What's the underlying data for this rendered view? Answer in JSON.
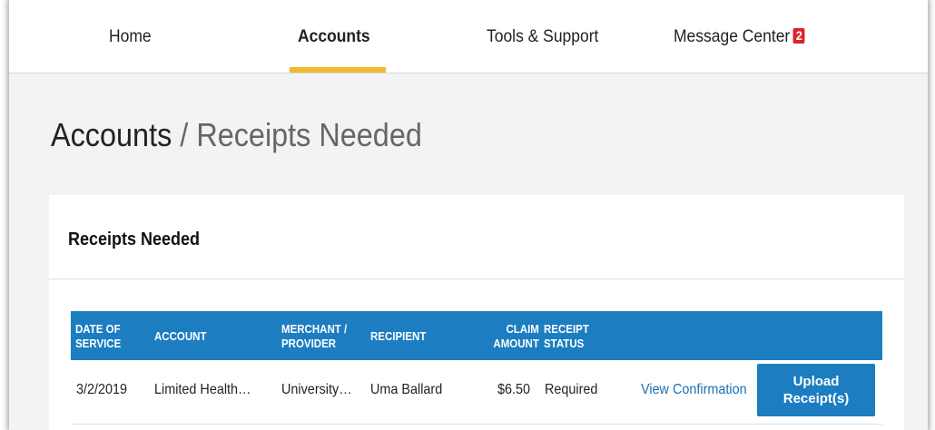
{
  "nav": {
    "items": [
      {
        "label": "Home"
      },
      {
        "label": "Accounts"
      },
      {
        "label": "Tools & Support"
      },
      {
        "label": "Message Center",
        "badge": "2"
      }
    ],
    "active": "Accounts"
  },
  "page": {
    "breadcrumb_root": "Accounts",
    "breadcrumb_sep": "/",
    "breadcrumb_current": "Receipts Needed"
  },
  "card": {
    "title": "Receipts Needed",
    "table": {
      "headers": {
        "date_line1": "DATE OF",
        "date_line2": "SERVICE",
        "account": "ACCOUNT",
        "merchant_line1": "MERCHANT /",
        "merchant_line2": "PROVIDER",
        "recipient": "RECIPIENT",
        "claim_line1": "CLAIM",
        "claim_line2": "AMOUNT",
        "status_line1": "RECEIPT",
        "status_line2": "STATUS"
      },
      "rows": [
        {
          "date": "3/2/2019",
          "account": "Limited Health…",
          "merchant": "University…",
          "recipient": "Uma Ballard",
          "amount": "$6.50",
          "status": "Required",
          "view_link": "View Confirmation",
          "upload_line1": "Upload",
          "upload_line2": "Receipt(s)"
        }
      ]
    }
  },
  "colors": {
    "accent": "#1c7dc1",
    "active_underline": "#f2b928",
    "badge": "#d9232e",
    "link": "#1a6fb5",
    "background": "#f1f3f5"
  }
}
